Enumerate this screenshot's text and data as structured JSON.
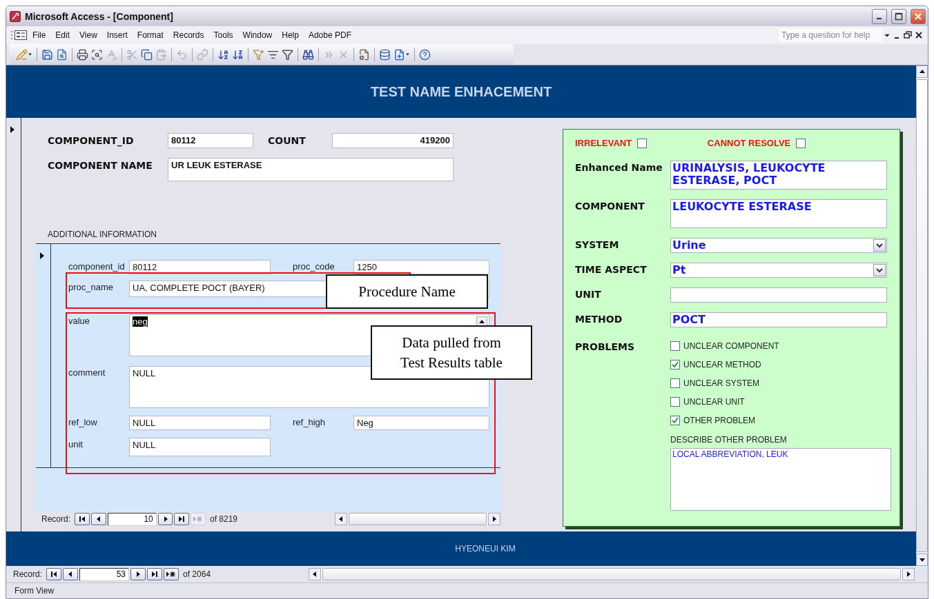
{
  "window": {
    "title": "Microsoft Access - [Component]"
  },
  "menu": {
    "items": [
      "File",
      "Edit",
      "View",
      "Insert",
      "Format",
      "Records",
      "Tools",
      "Window",
      "Help",
      "Adobe PDF"
    ],
    "help_placeholder": "Type a question for help"
  },
  "toolbar": [
    {
      "kind": "view",
      "disabled": false
    },
    {
      "kind": "separator"
    },
    {
      "kind": "save",
      "disabled": false
    },
    {
      "kind": "search",
      "disabled": false
    },
    {
      "kind": "separator"
    },
    {
      "kind": "print",
      "disabled": false
    },
    {
      "kind": "preview",
      "disabled": false
    },
    {
      "kind": "spelling",
      "disabled": true
    },
    {
      "kind": "separator"
    },
    {
      "kind": "cut",
      "disabled": true
    },
    {
      "kind": "copy",
      "disabled": false
    },
    {
      "kind": "paste",
      "disabled": true
    },
    {
      "kind": "separator"
    },
    {
      "kind": "undo",
      "disabled": true
    },
    {
      "kind": "separator"
    },
    {
      "kind": "hyperlink",
      "disabled": true
    },
    {
      "kind": "separator"
    },
    {
      "kind": "sortasc",
      "disabled": false
    },
    {
      "kind": "sortdesc",
      "disabled": false
    },
    {
      "kind": "separator"
    },
    {
      "kind": "filterselection",
      "disabled": false
    },
    {
      "kind": "filterform",
      "disabled": false
    },
    {
      "kind": "filter",
      "disabled": false
    },
    {
      "kind": "separator"
    },
    {
      "kind": "find",
      "disabled": false
    },
    {
      "kind": "separator"
    },
    {
      "kind": "newrecord",
      "disabled": true
    },
    {
      "kind": "delete",
      "disabled": true
    },
    {
      "kind": "separator"
    },
    {
      "kind": "properties",
      "disabled": false
    },
    {
      "kind": "separator"
    },
    {
      "kind": "database",
      "disabled": false
    },
    {
      "kind": "newobject",
      "disabled": false
    },
    {
      "kind": "separator"
    },
    {
      "kind": "help",
      "disabled": false
    }
  ],
  "form": {
    "header": "TEST NAME ENHACEMENT",
    "footer": "HYEONEUI KIM"
  },
  "component": {
    "component_id": {
      "label": "COMPONENT_ID",
      "value": "80112"
    },
    "count": {
      "label": "COUNT",
      "value": "419200"
    },
    "component_name": {
      "label": "COMPONENT NAME",
      "value": "UR LEUK ESTERASE"
    }
  },
  "additional_information": {
    "title": "ADDITIONAL INFORMATION",
    "rows": [
      {
        "kind": "pair",
        "fields": [
          {
            "label": "component_id",
            "value": "80112"
          },
          {
            "label": "proc_code",
            "value": "1250"
          }
        ]
      },
      {
        "kind": "wide",
        "fields": [
          {
            "label": "proc_name",
            "value": "UA, COMPLETE POCT (BAYER)"
          }
        ]
      },
      {
        "kind": "memo",
        "fields": [
          {
            "label": "value",
            "value": "neg",
            "highlighted": true,
            "scroll_arrow": true
          }
        ]
      },
      {
        "kind": "memo",
        "fields": [
          {
            "label": "comment",
            "value": "NULL",
            "highlighted": false
          }
        ]
      },
      {
        "kind": "pair",
        "fields": [
          {
            "label": "ref_low",
            "value": "NULL"
          },
          {
            "label": "ref_high",
            "value": "Neg"
          }
        ]
      },
      {
        "kind": "short",
        "fields": [
          {
            "label": "unit",
            "value": "NULL"
          }
        ]
      }
    ],
    "record_nav": {
      "label": "Record:",
      "current": "10",
      "total": "of 8219",
      "new_enabled": false
    }
  },
  "enhancement": {
    "flags": [
      {
        "label": "IRRELEVANT",
        "checked": false
      },
      {
        "label": "CANNOT RESOLVE",
        "checked": false
      }
    ],
    "fields": [
      {
        "kind": "memo",
        "label": "Enhanced Name",
        "value": "URINALYSIS, LEUKOCYTE ESTERASE, POCT"
      },
      {
        "kind": "memo",
        "label": "COMPONENT",
        "value": "LEUKOCYTE ESTERASE"
      },
      {
        "kind": "combo",
        "label": "SYSTEM",
        "value": "Urine"
      },
      {
        "kind": "combo",
        "label": "TIME ASPECT",
        "value": "Pt"
      },
      {
        "kind": "text",
        "label": "UNIT"
      },
      {
        "kind": "text",
        "label": "METHOD",
        "value": "POCT"
      }
    ],
    "problems": {
      "label": "PROBLEMS",
      "items": [
        {
          "label": "UNCLEAR COMPONENT",
          "checked": false
        },
        {
          "label": "UNCLEAR METHOD",
          "checked": true
        },
        {
          "label": "UNCLEAR SYSTEM",
          "checked": false
        },
        {
          "label": "UNCLEAR UNIT",
          "checked": false
        },
        {
          "label": "OTHER PROBLEM",
          "checked": true
        }
      ]
    },
    "describe": {
      "label": "DESCRIBE OTHER PROBLEM",
      "value": "LOCAL ABBREVIATION, LEUK"
    }
  },
  "annotations": [
    {
      "kind": "outline"
    },
    {
      "kind": "outline"
    },
    {
      "kind": "callout",
      "text": "Procedure Name"
    },
    {
      "kind": "callout",
      "text": "Data pulled from Test Results table"
    }
  ],
  "record_nav": {
    "label": "Record:",
    "current": "53",
    "total": "of 2064",
    "new_enabled": true
  },
  "status_bar": {
    "text": "Form View"
  }
}
